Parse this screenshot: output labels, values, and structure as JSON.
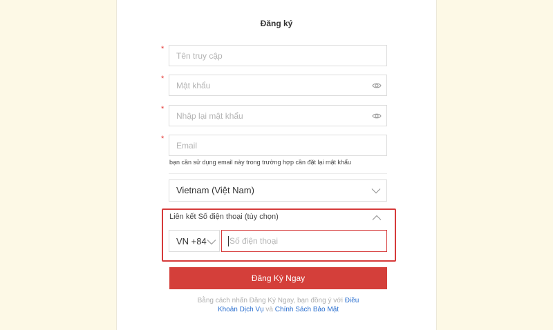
{
  "form": {
    "title": "Đăng ký",
    "required_mark": "*",
    "username": {
      "placeholder": "Tên truy cập",
      "value": ""
    },
    "password": {
      "placeholder": "Mật khẩu",
      "value": ""
    },
    "confirm_password": {
      "placeholder": "Nhập lại mật khẩu",
      "value": ""
    },
    "email": {
      "placeholder": "Email",
      "value": "",
      "hint": "bạn cần sử dụng email này trong trường hợp cần đặt lại mật khẩu"
    },
    "country": {
      "selected": "Vietnam (Việt Nam)"
    },
    "phone_link": {
      "label": "Liên kết Số điện thoại (tùy chọn)",
      "country_code": "VN +84",
      "placeholder": "Số điện thoại",
      "value": ""
    },
    "submit_label": "Đăng Ký Ngay",
    "terms": {
      "prefix": "Bằng cách nhấn Đăng Ký Ngay, bạn đồng ý với ",
      "terms_link": "Điều Khoản Dịch Vụ",
      "conjunction": " và ",
      "privacy_link": "Chính Sách Bảo Mật"
    }
  },
  "icons": {
    "password_toggle": "eye-icon",
    "dropdown": "chevron-down-icon",
    "collapse": "chevron-up-icon"
  },
  "colors": {
    "page_background": "#fdf9e6",
    "primary": "#d43f3a",
    "highlight_border": "#d63a3a",
    "link": "#2a6fd0"
  }
}
